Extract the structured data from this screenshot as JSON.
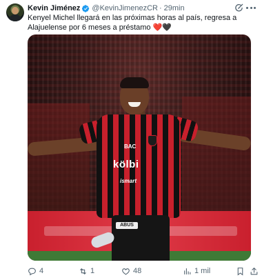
{
  "author": {
    "name": "Kevin Jiménez",
    "handle": "@KevinJimenezCR",
    "separator": "·",
    "time": "29min"
  },
  "tweet": {
    "text": "Kenyel Michel llegará en las próximas horas al país, regresa a Alajuelense por 6 meses a préstamo",
    "emoji_red_heart": "❤️",
    "emoji_black_heart": "🖤"
  },
  "media": {
    "sponsor_bac": "BAC",
    "sponsor_kolbi": "kölbi",
    "sponsor_ismart": "ismart",
    "shorts_logo": "ABUS"
  },
  "actions": {
    "reply_count": "4",
    "retweet_count": "1",
    "like_count": "48",
    "views_count": "1 mil"
  },
  "colors": {
    "verified_blue": "#1d9bf0",
    "secondary_text": "#536471",
    "primary_text": "#0f1419",
    "jersey_red": "#c8202c"
  },
  "icons": [
    "verified-icon",
    "grok-icon",
    "more-icon",
    "reply-icon",
    "retweet-icon",
    "like-icon",
    "views-icon",
    "bookmark-icon",
    "share-icon"
  ]
}
